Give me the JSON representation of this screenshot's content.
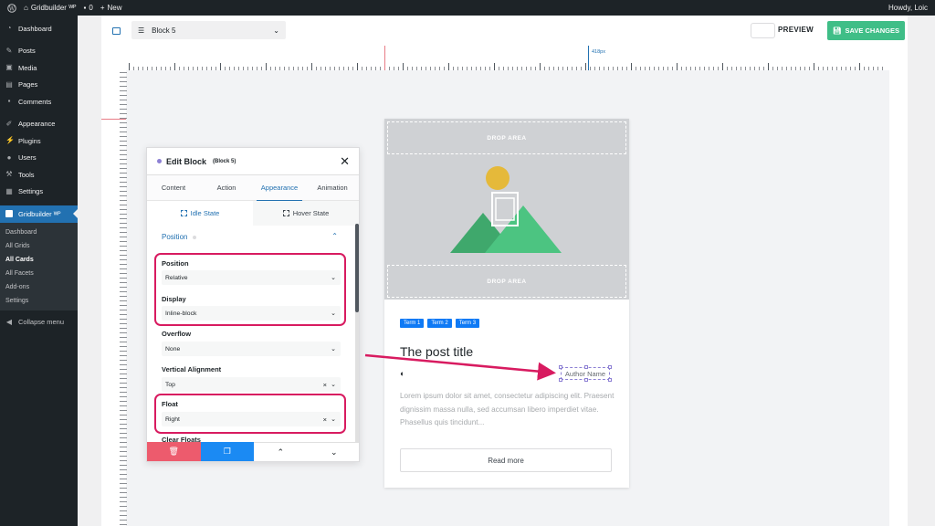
{
  "adminbar": {
    "site_name": "Gridbuilder ᵂᴾ",
    "comments_count": "0",
    "new_label": "New",
    "howdy": "Howdy, Loic"
  },
  "sidebar": {
    "items": [
      {
        "label": "Dashboard",
        "icon": "dashboard-icon"
      },
      {
        "label": "Posts",
        "icon": "pin-icon"
      },
      {
        "label": "Media",
        "icon": "media-icon"
      },
      {
        "label": "Pages",
        "icon": "pages-icon"
      },
      {
        "label": "Comments",
        "icon": "comment-icon"
      },
      {
        "label": "Appearance",
        "icon": "brush-icon"
      },
      {
        "label": "Plugins",
        "icon": "plug-icon"
      },
      {
        "label": "Users",
        "icon": "user-icon"
      },
      {
        "label": "Tools",
        "icon": "wrench-icon"
      },
      {
        "label": "Settings",
        "icon": "settings-icon"
      }
    ],
    "active_item": "Gridbuilder ᵂᴾ",
    "submenu": [
      "Dashboard",
      "All Grids",
      "All Cards",
      "All Facets",
      "Add-ons",
      "Settings"
    ],
    "submenu_current": "All Cards",
    "collapse_label": "Collapse menu"
  },
  "toolbar": {
    "block_select": "Block 5",
    "preview_label": "PREVIEW",
    "save_label": "SAVE CHANGES",
    "ruler_label": "418px"
  },
  "card": {
    "drop_top": "DROP AREA",
    "drop_bottom": "DROP AREA",
    "terms": [
      "Term 1",
      "Term 2",
      "Term 3"
    ],
    "title": "The post title",
    "author": "Author Name",
    "excerpt": "Lorem ipsum dolor sit amet, consectetur adipiscing elit. Praesent dignissim massa nulla, sed accumsan libero imperdiet vitae. Phasellus quis tincidunt...",
    "read_more": "Read more",
    "colors": {
      "sun": "#e5b93a",
      "mountain_dark": "#3fa86c",
      "mountain_light": "#4cc481",
      "media_bg": "#cfd1d4"
    }
  },
  "panel": {
    "title": "Edit Block",
    "subtitle": "(Block 5)",
    "tabs": [
      "Content",
      "Action",
      "Appearance",
      "Animation"
    ],
    "active_tab": "Appearance",
    "states": [
      "Idle State",
      "Hover State"
    ],
    "section": "Position",
    "fields": {
      "position": {
        "label": "Position",
        "value": "Relative"
      },
      "display": {
        "label": "Display",
        "value": "Inline-block"
      },
      "overflow": {
        "label": "Overflow",
        "value": "None"
      },
      "vertical_alignment": {
        "label": "Vertical Alignment",
        "value": "Top"
      },
      "float": {
        "label": "Float",
        "value": "Right"
      },
      "clear_floats": {
        "label": "Clear Floats"
      }
    }
  },
  "colors": {
    "accent": "#2271b1",
    "save": "#3fbe87",
    "highlight": "#d81b60",
    "delete": "#ed5b6d",
    "duplicate": "#1b8af3"
  }
}
